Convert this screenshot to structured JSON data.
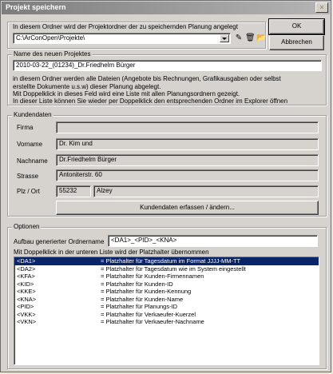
{
  "window": {
    "title": "Projekt speichern"
  },
  "buttons": {
    "ok": "OK",
    "cancel": "Abbrechen",
    "customer": "Kundendaten erfassen / ändern..."
  },
  "folder": {
    "label": "In diesem Ordner wird der Projektordner der zu speichernden Planung angelegt",
    "path": "C:\\ArConOpen\\Projekte\\"
  },
  "project": {
    "group_label": "Name des neuen Projektes",
    "name": "2010-03-22_(01234)_Dr.Friedhelm Bürger",
    "info": [
      "in diesem Ordner werden alle Dateien (Angebote bis Rechnungen, Grafikausgaben oder selbst",
      "erstellte Dokumente u.s.w) dieser Planung abgelegt.",
      "Mit Doppelklick in dieses Feld  wird eine Liste mit allen Planungsordnern gezeigt.",
      "In dieser Liste können Sie wieder per Doppelklick den entsprechenden Ordner im Explorer öffnen"
    ]
  },
  "customer": {
    "group_label": "Kundendaten",
    "labels": {
      "firma": "Firma",
      "vorname": "Vorname",
      "nachname": "Nachname",
      "strasse": "Strasse",
      "plz_ort": "Plz / Ort"
    },
    "values": {
      "firma": "",
      "vorname": "Dr. Kim und",
      "nachname": "Dr.Friedhelm Bürger",
      "strasse": "Antoniterstr. 60",
      "plz": "55232",
      "ort": "Alzey"
    }
  },
  "options": {
    "group_label": "Optionen",
    "folder_name_label": "Aufbau generierter Ordnername",
    "folder_name_value": "<DA1>_<PID>_<KNA>",
    "hint": "Mit Doppelklick in der unteren Liste wird der Platzhalter übernommen",
    "placeholders": [
      {
        "key": "<DA1>",
        "desc": "= Platzhalter für Tagesdatum im Format JJJJ-MM-TT"
      },
      {
        "key": "<DA2>",
        "desc": "= Platzhalter für Tagesdatum wie im System eingestellt"
      },
      {
        "key": "<KFA>",
        "desc": "= Platzhalter für Kunden-Firmennamen"
      },
      {
        "key": "<KID>",
        "desc": "= Platzhalter für Kunden-ID"
      },
      {
        "key": "<KKE>",
        "desc": "= Platzhalter für Kunden-Kennung"
      },
      {
        "key": "<KNA>",
        "desc": "= Platzhalter für Kunden-Name"
      },
      {
        "key": "<PID>",
        "desc": "= Platzhalter für Planungs-ID"
      },
      {
        "key": "<VKK>",
        "desc": "= Platzhalter für Verkaeufer-Kuerzel"
      },
      {
        "key": "<VKN>",
        "desc": "= Platzhalter für Verkaeufer-Nachname"
      }
    ]
  }
}
